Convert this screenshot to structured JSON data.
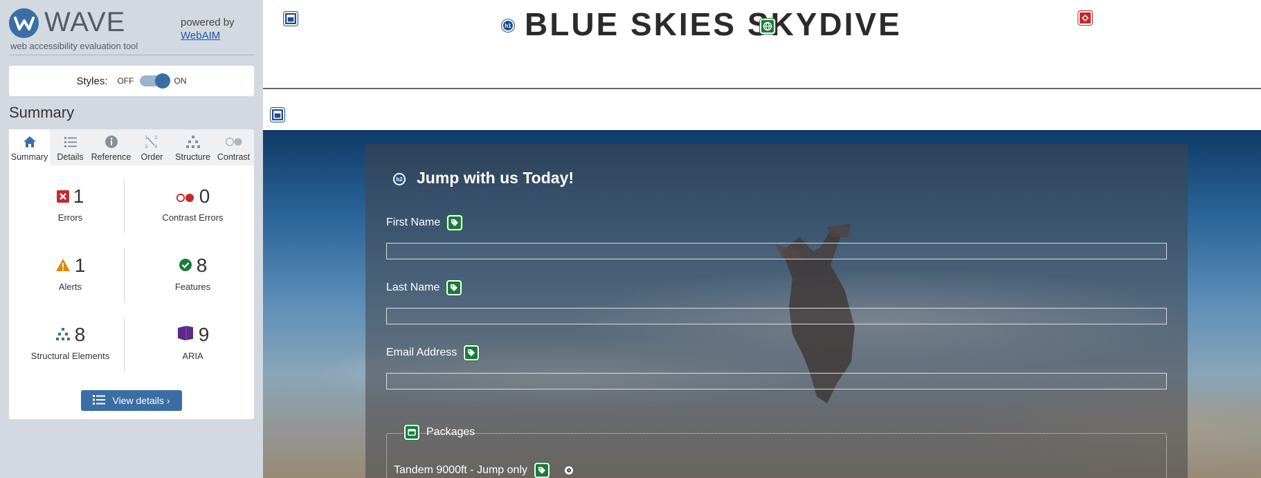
{
  "wave": {
    "logo_text": "WAVE",
    "tagline": "web accessibility evaluation tool",
    "powered_by": "powered by",
    "webaim_link": "WebAIM",
    "styles_label": "Styles:",
    "styles_off": "OFF",
    "styles_on": "ON",
    "summary_heading": "Summary",
    "tabs": [
      {
        "label": "Summary",
        "icon": "home-icon"
      },
      {
        "label": "Details",
        "icon": "list-icon"
      },
      {
        "label": "Reference",
        "icon": "info-icon"
      },
      {
        "label": "Order",
        "icon": "order-icon"
      },
      {
        "label": "Structure",
        "icon": "structure-icon"
      },
      {
        "label": "Contrast",
        "icon": "contrast-icon"
      }
    ],
    "stats": {
      "errors": {
        "count": "1",
        "label": "Errors"
      },
      "contrast_errors": {
        "count": "0",
        "label": "Contrast Errors"
      },
      "alerts": {
        "count": "1",
        "label": "Alerts"
      },
      "features": {
        "count": "8",
        "label": "Features"
      },
      "structural": {
        "count": "8",
        "label": "Structural Elements"
      },
      "aria": {
        "count": "9",
        "label": "ARIA"
      }
    },
    "view_details": "View details ›",
    "colors": {
      "accent": "#3a6ea5",
      "error": "#c62828",
      "alert": "#e08a00",
      "feature": "#1e7a3a",
      "aria": "#5b2a86"
    }
  },
  "site": {
    "title": "BLUE SKIES SKYDIVE",
    "h1_badge": "h1",
    "h2_badge": "h2",
    "form": {
      "heading": "Jump with us Today!",
      "first_name": "First Name",
      "last_name": "Last Name",
      "email": "Email Address",
      "first_name_value": "",
      "last_name_value": "",
      "email_value": "",
      "packages_legend": "Packages",
      "package_option_1": "Tandem 9000ft - Jump only"
    }
  }
}
